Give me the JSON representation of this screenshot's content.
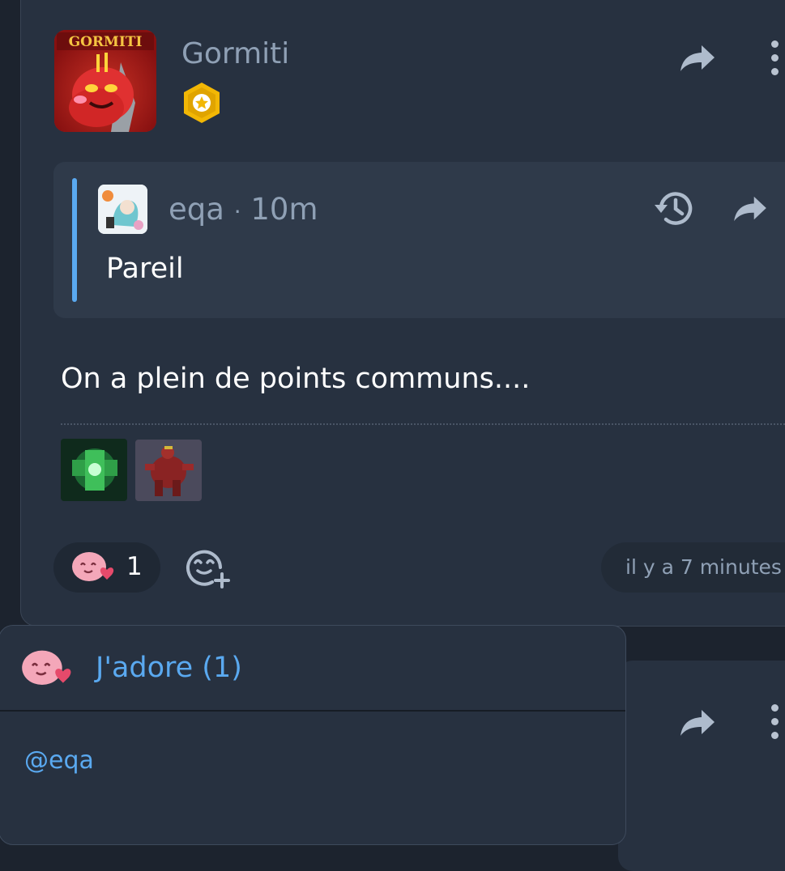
{
  "note": {
    "author": "Gormiti",
    "avatar_label": "GORMITI",
    "quote": {
      "author": "eqa",
      "separator": "·",
      "time": "10m",
      "text": "Pareil"
    },
    "text": "On a plein de points communs....",
    "reactions": [
      {
        "emoji": "heart-blob-icon",
        "count": "1"
      }
    ],
    "timestamp": "il y a 7 minutes"
  },
  "reaction_popup": {
    "title": "J'adore (1)",
    "users": [
      "@eqa"
    ]
  },
  "colors": {
    "background": "#1c232e",
    "card": "#273140",
    "quote_bg": "#2f3a4a",
    "accent": "#5aa9f0",
    "muted_text": "#8fa0b5"
  }
}
